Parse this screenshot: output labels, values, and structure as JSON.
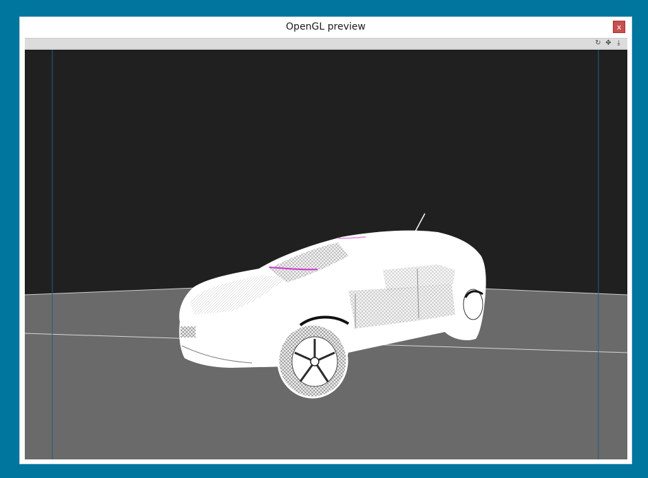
{
  "window": {
    "title": "OpenGL preview",
    "close_label": "x"
  },
  "toolbar": {
    "icons": [
      {
        "name": "rotate-icon",
        "glyph": "↻"
      },
      {
        "name": "move-icon",
        "glyph": "✥"
      },
      {
        "name": "download-icon",
        "glyph": "⤓"
      }
    ]
  },
  "viewport": {
    "background_color": "#202020",
    "floor_color": "#6a6a6a",
    "wireframe_color": "#ffffff",
    "guide_line_color": "#1f5f86"
  }
}
